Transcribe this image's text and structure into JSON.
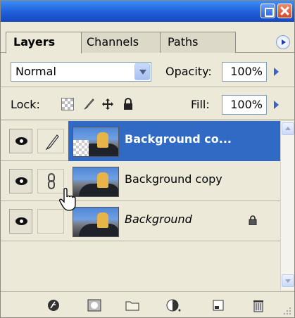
{
  "tabs": [
    {
      "label": "Layers",
      "active": true
    },
    {
      "label": "Channels",
      "active": false
    },
    {
      "label": "Paths",
      "active": false
    }
  ],
  "blend": {
    "mode": "Normal"
  },
  "opacity": {
    "label": "Opacity:",
    "value": "100%"
  },
  "lock": {
    "label": "Lock:"
  },
  "fill": {
    "label": "Fill:",
    "value": "100%"
  },
  "layers": [
    {
      "name": "Background co...",
      "selected": true,
      "italic": false,
      "locked": false
    },
    {
      "name": "Background copy",
      "selected": false,
      "italic": false,
      "locked": false
    },
    {
      "name": "Background",
      "selected": false,
      "italic": true,
      "locked": true
    }
  ],
  "colors": {
    "selection": "#316ac5",
    "panel": "#ece9d8",
    "titlebar": "#1f5fd8"
  },
  "icons": [
    "minimize-icon",
    "close-icon",
    "panel-menu-icon",
    "dropdown-arrow-icon",
    "eye-icon",
    "brush-icon",
    "chain-link-icon",
    "lock-icon",
    "fx-icon",
    "mask-icon",
    "folder-icon",
    "adjustment-layer-icon",
    "new-layer-icon",
    "trash-icon",
    "hand-cursor-icon"
  ]
}
